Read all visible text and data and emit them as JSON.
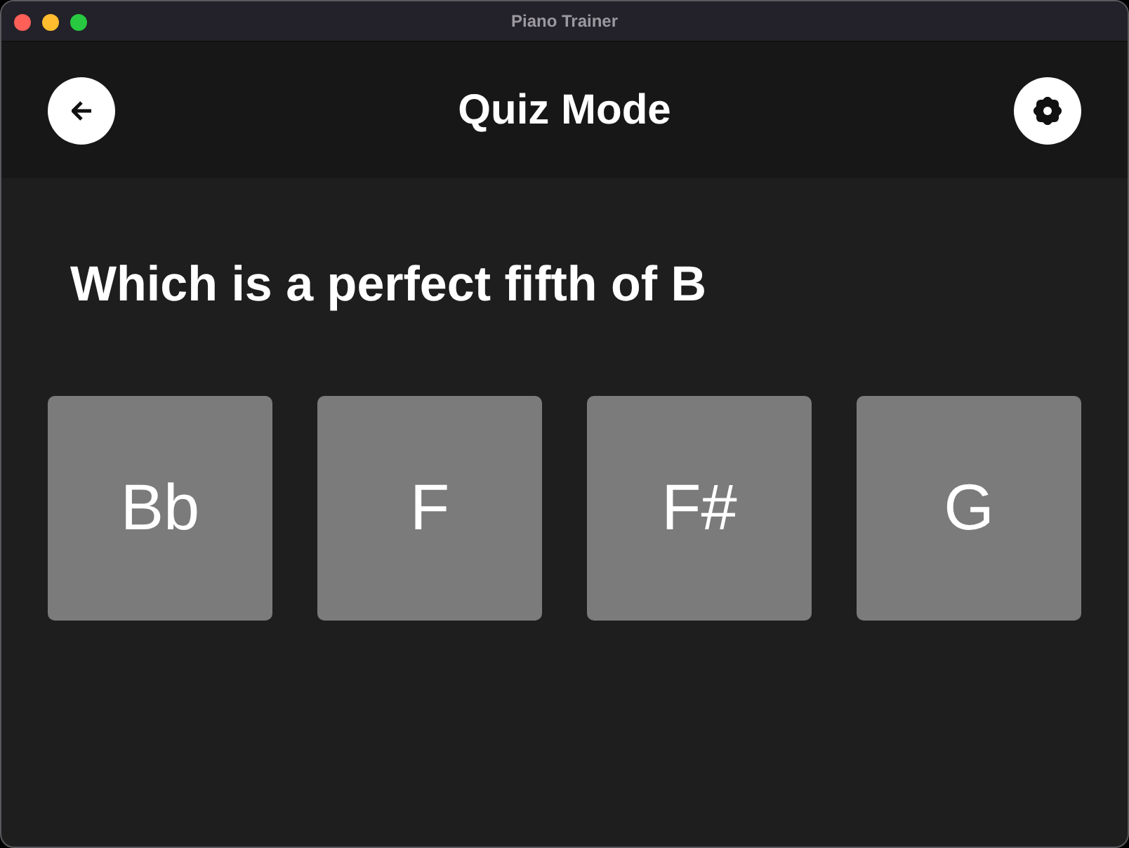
{
  "window": {
    "title": "Piano Trainer"
  },
  "header": {
    "title": "Quiz Mode"
  },
  "question": "Which is a perfect fifth of B",
  "options": [
    {
      "label": "Bb"
    },
    {
      "label": "F"
    },
    {
      "label": "F#"
    },
    {
      "label": "G"
    }
  ]
}
